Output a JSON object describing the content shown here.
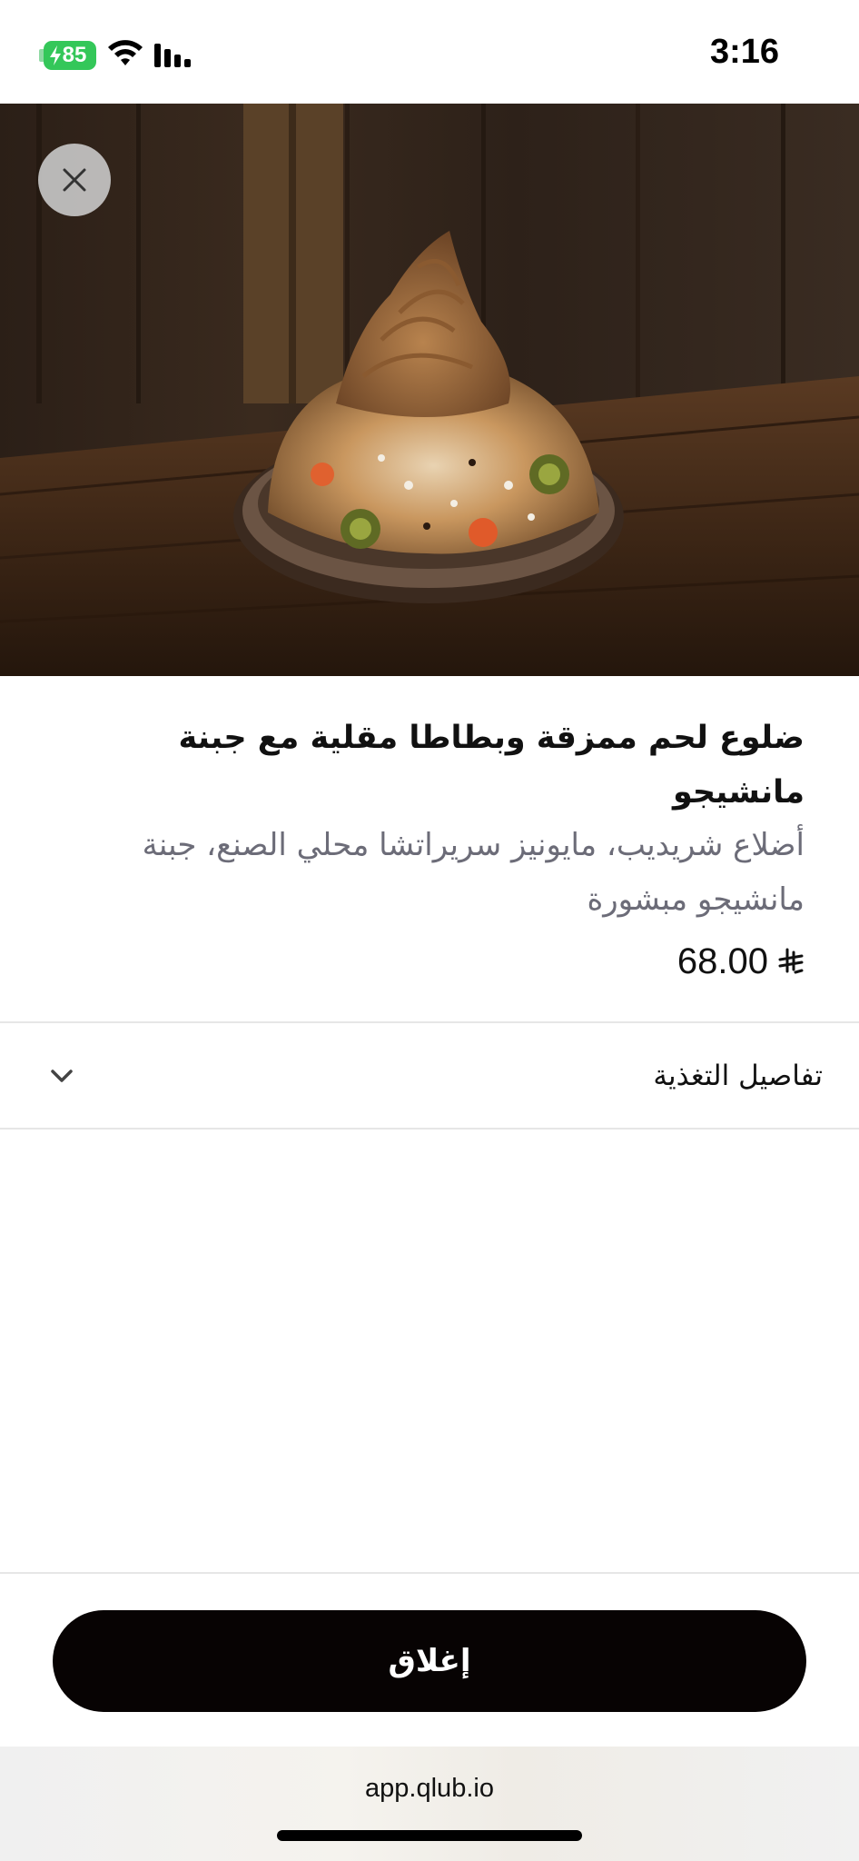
{
  "status_bar": {
    "time": "3:16",
    "battery": "85",
    "icons": [
      "battery-charging-icon",
      "wifi-icon",
      "cellular-signal-icon"
    ]
  },
  "hero": {
    "image_description": "dish-photo",
    "close_icon": "close-icon"
  },
  "item": {
    "title": "ضلوع لحم ممزقة وبطاطا مقلية مع جبنة مانشيجو",
    "description": "أضلاع شريديب، مايونيز سريراتشا محلي الصنع، جبنة مانشيجو مبشورة",
    "price": "68.00",
    "currency_icon": "saudi-riyal-icon"
  },
  "nutrition": {
    "label": "تفاصيل التغذية",
    "icon": "chevron-down-icon"
  },
  "footer": {
    "close_button_label": "إغلاق"
  },
  "browser": {
    "url": "app.qlub.io"
  },
  "colors": {
    "button_bg": "#070303",
    "description_text": "#6c6c78",
    "battery_green": "#34c759"
  }
}
